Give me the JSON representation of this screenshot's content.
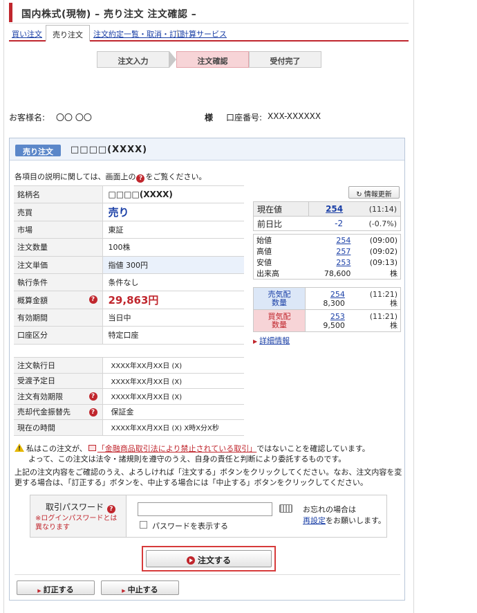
{
  "page": {
    "title": "国内株式(現物) – 売り注文 注文確認 –"
  },
  "tabs": {
    "buy": "買い注文",
    "sell": "売り注文",
    "list": "注文約定一覧・取消・訂正",
    "calc": "計算サービス"
  },
  "steps": [
    "注文入力",
    "注文確認",
    "受付完了"
  ],
  "customer": {
    "label": "お客様名:",
    "name": "〇〇 〇〇",
    "suffix": "様",
    "account_label": "口座番号:",
    "account": "XXX-XXXXXX"
  },
  "order": {
    "badge": "売り注文",
    "stock": "□□□□(XXXX)",
    "help_prefix": "各項目の説明に関しては、画面上の",
    "help_suffix": "をご覧ください。",
    "help_mark": "?",
    "rows": [
      {
        "label": "銘柄名",
        "value": "□□□□(XXXX)"
      },
      {
        "label": "売買",
        "value": "売り"
      },
      {
        "label": "市場",
        "value": "東証"
      },
      {
        "label": "注文数量",
        "value": "100株"
      },
      {
        "label": "注文単価",
        "value": "指値 300円"
      },
      {
        "label": "執行条件",
        "value": "条件なし"
      },
      {
        "label": "概算金額",
        "value": "29,863円"
      },
      {
        "label": "有効期間",
        "value": "当日中"
      },
      {
        "label": "口座区分",
        "value": "特定口座"
      }
    ],
    "dates": [
      {
        "label": "注文執行日",
        "value": "XXXX年XX月XX日 (X)"
      },
      {
        "label": "受渡予定日",
        "value": "XXXX年XX月XX日 (X)"
      },
      {
        "label": "注文有効期限",
        "value": "XXXX年XX月XX日 (X)"
      },
      {
        "label": "売却代金振替先",
        "value": "保証金"
      },
      {
        "label": "現在の時間",
        "value": "XXXX年XX月XX日 (X) X時X分X秒"
      }
    ]
  },
  "quote": {
    "refresh": "情報更新",
    "price_label": "現在値",
    "price": "254",
    "price_time": "(11:14)",
    "change_label": "前日比",
    "change": "-2",
    "change_pct": "(-0.7%)",
    "ohlc": [
      {
        "label": "始値",
        "value": "254",
        "time": "(09:00)"
      },
      {
        "label": "高値",
        "value": "257",
        "time": "(09:02)"
      },
      {
        "label": "安値",
        "value": "253",
        "time": "(09:13)"
      },
      {
        "label": "出来高",
        "value": "78,600",
        "time": "株"
      }
    ],
    "sell_board": {
      "label1": "売気配",
      "label2": "数量",
      "price": "254",
      "qty": "8,300",
      "time": "(11:21)",
      "unit": "株"
    },
    "buy_board": {
      "label1": "買気配",
      "label2": "数量",
      "price": "253",
      "qty": "9,500",
      "time": "(11:21)",
      "unit": "株"
    },
    "detail_link": "詳細情報"
  },
  "warning": {
    "line1_prefix": "私はこの注文が、",
    "line1_link": "「金融商品取引法により禁止されている取引」",
    "line1_suffix": "ではないことを確認しています。",
    "line2": "よって、この注文は法令・諸規則を遵守のうえ、自身の責任と判断により委託するものです。",
    "confirm": "上記の注文内容をご確認のうえ、よろしければ「注文する」ボタンをクリックしてください。なお、注文内容を変更する場合は、「訂正する」ボタンを、中止する場合には「中止する」ボタンをクリックしてください。"
  },
  "password": {
    "label": "取引パスワード",
    "note": "※ログインパスワードとは異なります",
    "show": "パスワードを表示する",
    "forgot_prefix": "お忘れの場合は",
    "forgot_link": "再設定",
    "forgot_suffix": "をお願いします。"
  },
  "buttons": {
    "submit": "注文する",
    "correct": "訂正する",
    "cancel": "中止する"
  },
  "colors": {
    "accent": "#c0262d",
    "link": "#1a3fa6",
    "badge": "#5b87c9"
  }
}
